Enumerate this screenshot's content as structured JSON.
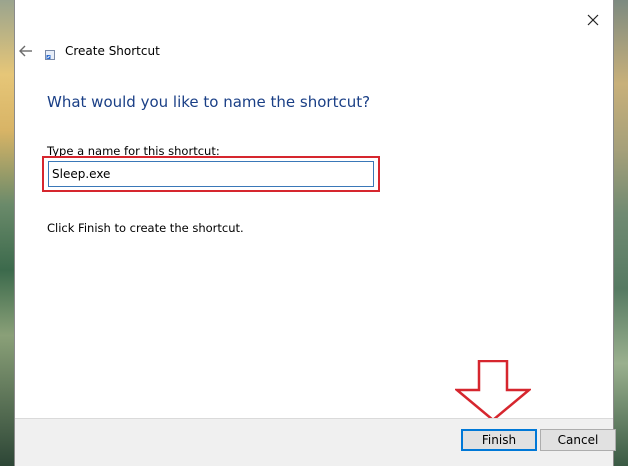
{
  "dialog": {
    "title": "Create Shortcut",
    "heading": "What would you like to name the shortcut?",
    "field_label": "Type a name for this shortcut:",
    "name_value": "Sleep.exe",
    "info_text": "Click Finish to create the shortcut.",
    "buttons": {
      "finish": "Finish",
      "cancel": "Cancel"
    }
  },
  "colors": {
    "heading": "#1a3f86",
    "highlight": "#d6262e",
    "input_border": "#3a78b8",
    "finish_border": "#0078d7"
  },
  "icons": {
    "close": "close-icon",
    "back": "back-arrow-icon",
    "shortcut": "shortcut-icon",
    "annotation": "red-down-arrow-icon"
  }
}
